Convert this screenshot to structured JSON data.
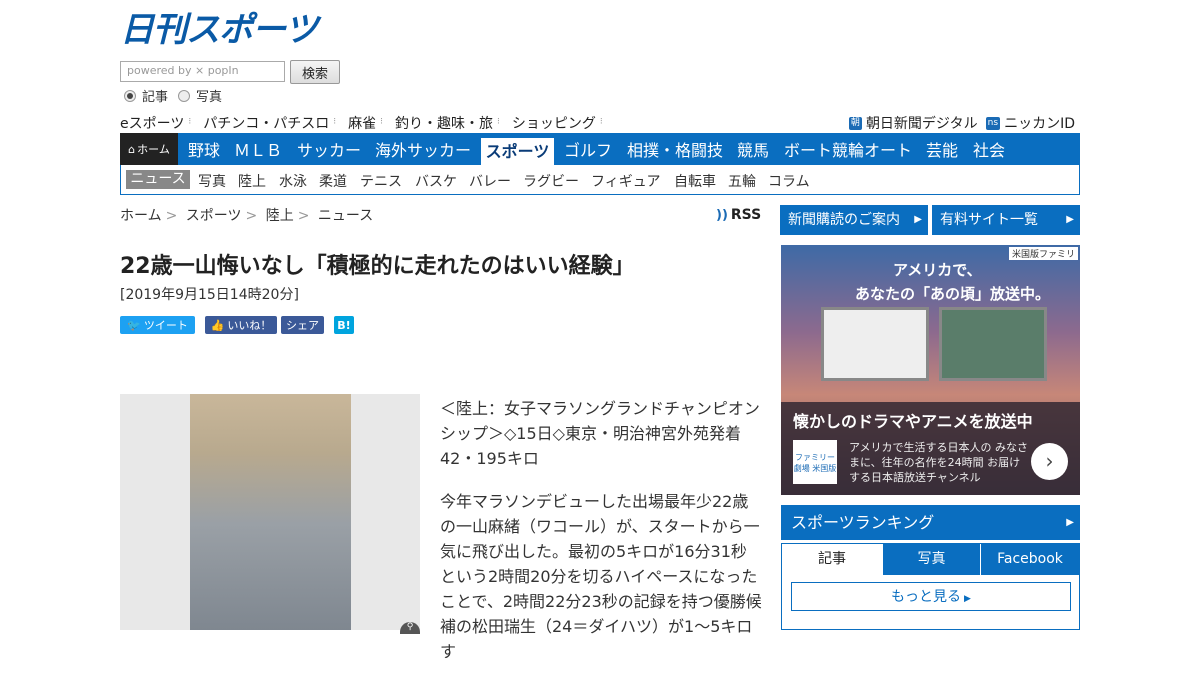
{
  "header": {
    "logo": "日刊スポーツ",
    "search_placeholder": "powered by ⨯ popIn",
    "search_button": "検索",
    "radio_article": "記事",
    "radio_photo": "写真"
  },
  "topnav": {
    "left": [
      "eスポーツ",
      "パチンコ・パチスロ",
      "麻雀",
      "釣り・趣味・旅",
      "ショッピング"
    ],
    "right": [
      {
        "badge": "朝",
        "label": "朝日新聞デジタル"
      },
      {
        "badge": "ns",
        "label": "ニッカンID"
      }
    ]
  },
  "mainnav": {
    "home": "ホーム",
    "items": [
      "野球",
      "ＭＬＢ",
      "サッカー",
      "海外サッカー",
      "スポーツ",
      "ゴルフ",
      "相撲・格闘技",
      "競馬",
      "ボート競輪オート",
      "芸能",
      "社会"
    ],
    "active": "スポーツ"
  },
  "subnav": {
    "items": [
      "ニュース",
      "写真",
      "陸上",
      "水泳",
      "柔道",
      "テニス",
      "バスケ",
      "バレー",
      "ラグビー",
      "フィギュア",
      "自転車",
      "五輪",
      "コラム"
    ],
    "active": "ニュース"
  },
  "breadcrumb": [
    "ホーム",
    "スポーツ",
    "陸上",
    "ニュース"
  ],
  "rss": "RSS",
  "article": {
    "title": "22歳一山悔いなし「積極的に走れたのはいい経験」",
    "date": "[2019年9月15日14時20分]",
    "share": {
      "tweet": "ツイート",
      "like": "いいね！",
      "share": "シェア",
      "hatena": "B!"
    },
    "lead": "＜陸上：女子マラソングランドチャンピオンシップ＞◇15日◇東京・明治神宮外苑発着42・195キロ",
    "body": "今年マラソンデビューした出場最年少22歳の一山麻緒（ワコール）が、スタートから一気に飛び出した。最初の5キロが16分31秒という2時間20分を切るハイペースになったことで、2時間22分23秒の記録を持つ優勝候補の松田瑞生（24＝ダイハツ）が1～5キロす"
  },
  "sidebar": {
    "subscribe": "新聞購読のご案内",
    "paid_sites": "有料サイト一覧",
    "ad": {
      "badge": "米国版ファミリ",
      "headline1": "アメリカで、",
      "headline2": "あなたの「あの頃」放送中。",
      "banner": "懐かしのドラマやアニメを放送中",
      "small": "アメリカで生活する日本人の みなさまに、往年の名作を24時間 お届けする日本語放送チャンネル",
      "logo": "ファミリー劇場 米国版"
    },
    "ranking_title": "スポーツランキング",
    "tabs": [
      "記事",
      "写真",
      "Facebook"
    ],
    "more": "もっと見る"
  },
  "colors": {
    "brand": "#0a6ec0",
    "logo": "#0a5aa6"
  }
}
